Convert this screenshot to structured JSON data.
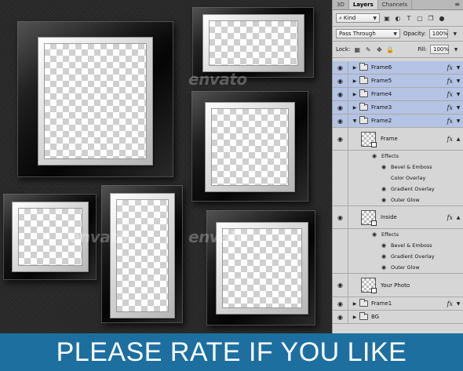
{
  "watermark": "envato",
  "panel": {
    "tabs": [
      "3D",
      "Layers",
      "Channels"
    ],
    "active_tab": "Layers",
    "panel_menu_icon": "panel-menu-icon",
    "filter": {
      "value": "Kind",
      "icon": "search-icon"
    },
    "blend_mode": "Pass Through",
    "opacity_label": "Opacity:",
    "opacity_value": "100%",
    "lock_label": "Lock:",
    "fill_label": "Fill:",
    "fill_value": "100%",
    "layers": [
      {
        "name": "Frame6",
        "type": "group",
        "selected": true,
        "fx": "fx"
      },
      {
        "name": "Frame5",
        "type": "group",
        "selected": true,
        "fx": "fx"
      },
      {
        "name": "Frame4",
        "type": "group",
        "selected": true,
        "fx": "fx"
      },
      {
        "name": "Frame3",
        "type": "group",
        "selected": true,
        "fx": "fx"
      },
      {
        "name": "Frame2",
        "type": "group-open",
        "selected": true,
        "fx": "fx"
      },
      {
        "name": "Frame",
        "type": "layer",
        "fx": "fx",
        "effects_label": "Effects",
        "effects": [
          "Bevel & Emboss",
          "Color Overlay",
          "Gradient Overlay",
          "Outer Glow"
        ]
      },
      {
        "name": "Inside",
        "type": "layer",
        "fx": "fx",
        "effects_label": "Effects",
        "effects": [
          "Bevel & Emboss",
          "Gradient Overlay",
          "Outer Glow"
        ]
      },
      {
        "name": "Your Photo",
        "type": "smart"
      },
      {
        "name": "Frame1",
        "type": "group",
        "fx": "fx"
      },
      {
        "name": "BG",
        "type": "group"
      }
    ]
  },
  "banner": "PLEASE RATE IF YOU LIKE"
}
